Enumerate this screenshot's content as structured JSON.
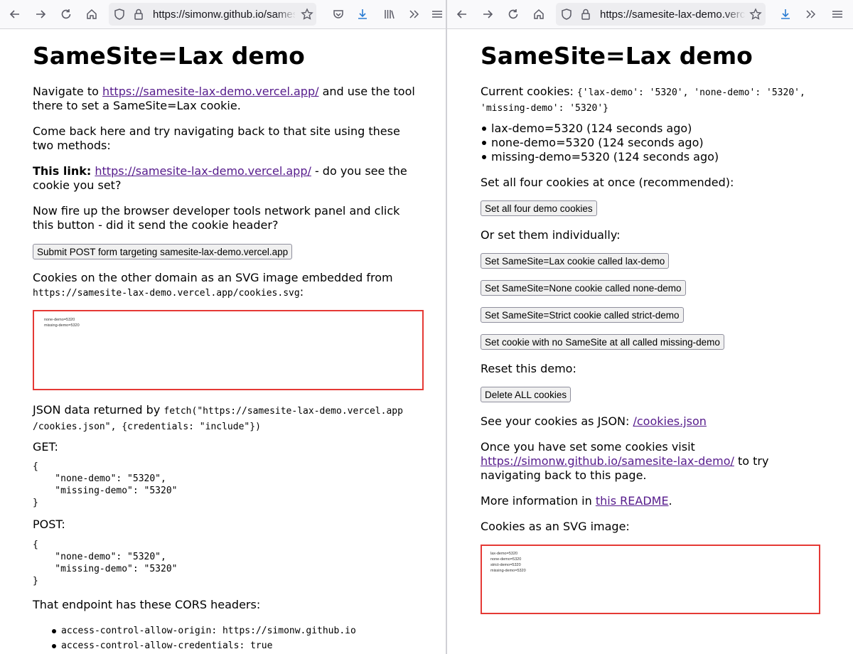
{
  "left_window": {
    "url": "https://simonw.github.io/samesite-lax-demo/",
    "page": {
      "title": "SameSite=Lax demo",
      "p1_before": "Navigate to ",
      "p1_link": "https://samesite-lax-demo.vercel.app/",
      "p1_line1_after": " and use the tool",
      "p1_line2": "there to set a SameSite=Lax cookie.",
      "p2_line1": "Come back here and try navigating back to that site using these",
      "p2_line2": "two methods:",
      "p3_bold": "This link:",
      "p3_link": "https://samesite-lax-demo.vercel.app/",
      "p3_line1_after": " - do you see the",
      "p3_line2": "cookie you set?",
      "p4_line1": "Now fire up the browser developer tools network panel and click",
      "p4_line2": "this button - did it send the cookie header?",
      "submit_button": "Submit POST form targeting samesite-lax-demo.vercel.app",
      "p5_line1": "Cookies on the other domain as an SVG image embedded from",
      "p5_code": "https://samesite-lax-demo.vercel.app/cookies.svg",
      "p5_colon": ":",
      "svg_lines": [
        "none-demo=5320",
        "missing-demo=5320"
      ],
      "json_intro": "JSON data returned by ",
      "json_code_line1": "fetch(\"https://samesite-lax-demo.vercel.app",
      "json_code_line2": "/cookies.json\", {credentials: \"include\"})",
      "get_label": "GET:",
      "get_json": "{\n    \"none-demo\": \"5320\",\n    \"missing-demo\": \"5320\"\n}",
      "post_label": "POST:",
      "post_json": "{\n    \"none-demo\": \"5320\",\n    \"missing-demo\": \"5320\"\n}",
      "cors_intro": "That endpoint has these CORS headers:",
      "cors_headers": [
        "access-control-allow-origin: https://simonw.github.io",
        "access-control-allow-credentials: true"
      ]
    }
  },
  "right_window": {
    "url": "https://samesite-lax-demo.vercel.app/",
    "page": {
      "title": "SameSite=Lax demo",
      "current_label": "Current cookies: ",
      "current_code_line1": "{'lax-demo': '5320', 'none-demo': '5320',",
      "current_code_line2": "'missing-demo': '5320'}",
      "cookie_list": [
        "lax-demo=5320 (124 seconds ago)",
        "none-demo=5320 (124 seconds ago)",
        "missing-demo=5320 (124 seconds ago)"
      ],
      "set_all_intro": "Set all four cookies at once (recommended):",
      "set_all_button": "Set all four demo cookies",
      "individually_intro": "Or set them individually:",
      "buttons": [
        "Set SameSite=Lax cookie called lax-demo",
        "Set SameSite=None cookie called none-demo",
        "Set SameSite=Strict cookie called strict-demo",
        "Set cookie with no SameSite at all called missing-demo"
      ],
      "reset_intro": "Reset this demo:",
      "delete_button": "Delete ALL cookies",
      "json_intro": "See your cookies as JSON: ",
      "json_link": "/cookies.json",
      "once_line1": "Once you have set some cookies visit",
      "once_link": "https://simonw.github.io/samesite-lax-demo/",
      "once_after": " to try",
      "once_line2": "navigating back to this page.",
      "more_before": "More information in ",
      "more_link": "this README",
      "more_after": ".",
      "svg_intro": "Cookies as an SVG image:",
      "svg_lines": [
        "lax-demo=5320",
        "none-demo=5320",
        "strict-demo=5320",
        "missing-demo=5320"
      ]
    }
  },
  "colors": {
    "link": "#551a8b",
    "svg_border": "#e53935",
    "toolbar_bg": "#f9f9fb",
    "urlbar_bg": "#ededf0"
  }
}
